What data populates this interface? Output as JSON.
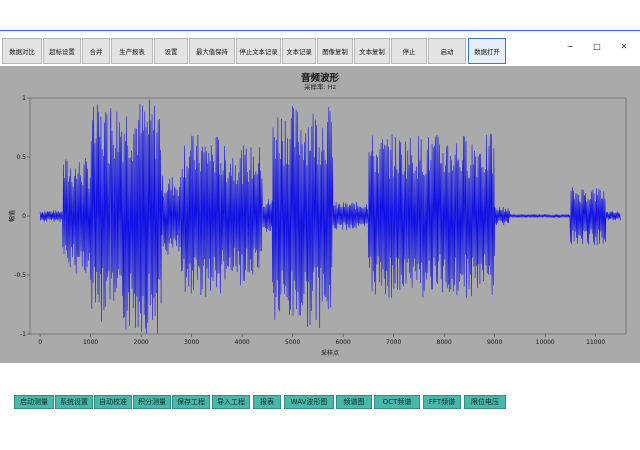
{
  "toolbar": {
    "buttons": [
      "数据对比",
      "超标设置",
      "合并",
      "生产报表",
      "设置",
      "最大值保持",
      "停止文本记录",
      "文本记录",
      "图像复制",
      "文本复制",
      "停止",
      "启动",
      "数据打开"
    ],
    "active": "数据打开"
  },
  "window_controls": [
    "−",
    "□",
    "✕"
  ],
  "chart_data": {
    "type": "line",
    "title": "音频波形",
    "subtitle": "采样率: Hz",
    "xlabel": "采样点",
    "ylabel": "幅值",
    "xlim": [
      -200,
      11600
    ],
    "ylim": [
      -1,
      1
    ],
    "x_ticks": [
      0,
      1000,
      2000,
      3000,
      4000,
      5000,
      6000,
      7000,
      8000,
      9000,
      10000,
      11000
    ],
    "y_ticks": [
      1,
      0.5,
      0,
      -0.5,
      -1
    ],
    "y_tick_labels": [
      "1",
      "0.5",
      "0",
      "-0.5",
      "-1"
    ],
    "line_color": "#1010e6",
    "background": "#aaaaaa",
    "grid": false,
    "segments": [
      {
        "x_start": 0,
        "x_end": 450,
        "amplitude": 0.05
      },
      {
        "x_start": 450,
        "x_end": 1000,
        "amplitude": 0.5
      },
      {
        "x_start": 1000,
        "x_end": 1400,
        "amplitude": 0.95
      },
      {
        "x_start": 1400,
        "x_end": 2400,
        "amplitude": 1.0
      },
      {
        "x_start": 2400,
        "x_end": 2800,
        "amplitude": 0.35
      },
      {
        "x_start": 2800,
        "x_end": 3600,
        "amplitude": 0.7
      },
      {
        "x_start": 3600,
        "x_end": 4400,
        "amplitude": 0.6
      },
      {
        "x_start": 4400,
        "x_end": 4600,
        "amplitude": 0.15
      },
      {
        "x_start": 4600,
        "x_end": 5800,
        "amplitude": 0.95
      },
      {
        "x_start": 5800,
        "x_end": 6500,
        "amplitude": 0.12
      },
      {
        "x_start": 6500,
        "x_end": 9000,
        "amplitude": 0.7
      },
      {
        "x_start": 9000,
        "x_end": 9300,
        "amplitude": 0.08
      },
      {
        "x_start": 9300,
        "x_end": 10500,
        "amplitude": 0.015
      },
      {
        "x_start": 10500,
        "x_end": 11200,
        "amplitude": 0.25
      },
      {
        "x_start": 11200,
        "x_end": 11500,
        "amplitude": 0.04
      }
    ]
  },
  "bottombar": {
    "buttons": [
      "启动测量",
      "系统设置",
      "自动校准",
      "积分测量",
      "保存工程",
      "导入工程",
      "报表",
      "WAV波形图",
      "频谱图",
      "OCT频谱",
      "FFT频谱",
      "限位电压"
    ]
  }
}
